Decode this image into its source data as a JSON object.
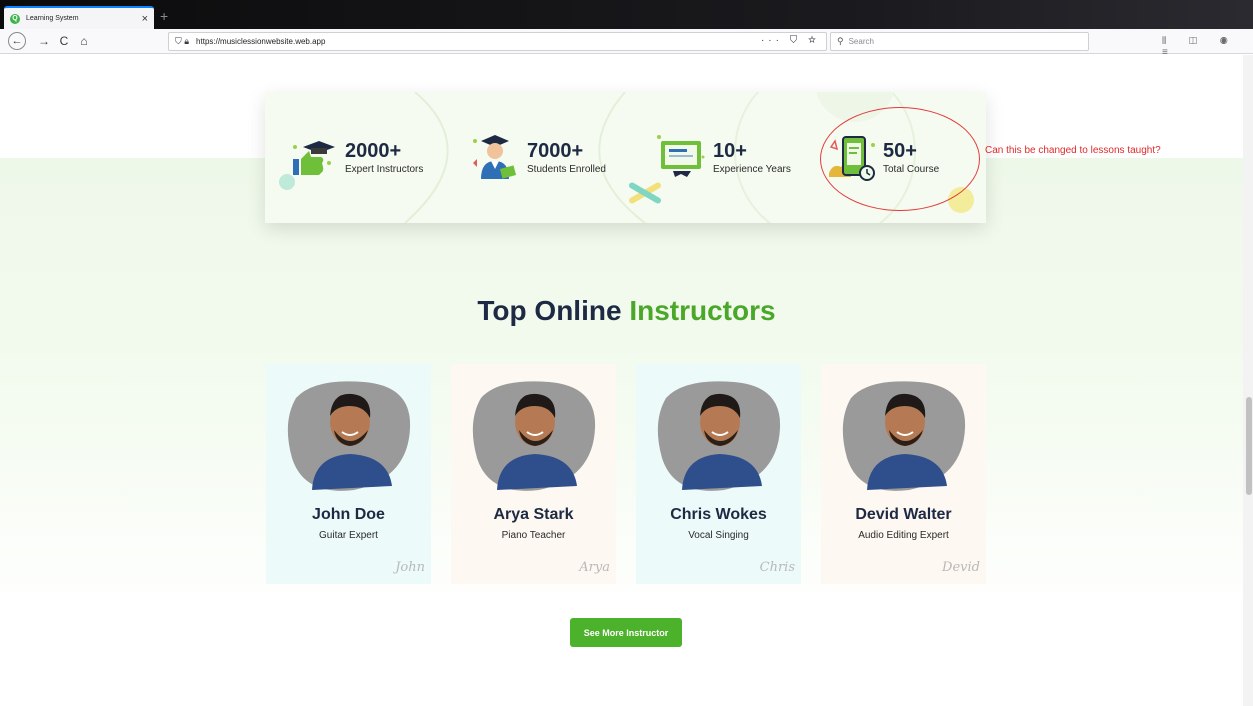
{
  "browser": {
    "tab_title": "Learning System",
    "tab_close": "×",
    "new_tab": "+",
    "url": "https://musiclessionwebsite.web.app",
    "url_actions": "··· ⛉ ☆",
    "search_placeholder": "Search",
    "nav": {
      "back": "←",
      "forward": "→",
      "reload": "C",
      "home": "⌂"
    },
    "right_icons": "⫴ ◫ ◉ ≡"
  },
  "colors": {
    "navy": "#1e2a44",
    "green": "#4aa72a",
    "annotation": "#e23b3b"
  },
  "stats": [
    {
      "value": "2000+",
      "label": "Expert Instructors",
      "icon": "graduation-thumbs-up-icon"
    },
    {
      "value": "7000+",
      "label": "Students Enrolled",
      "icon": "graduate-student-icon"
    },
    {
      "value": "10+",
      "label": "Experience Years",
      "icon": "certificate-icon"
    },
    {
      "value": "50+",
      "label": "Total Course",
      "icon": "tablet-clock-icon"
    }
  ],
  "annotation": {
    "note": "Can this be changed to lessons taught?"
  },
  "section": {
    "title_part1": "Top Online ",
    "title_part2": "Instructors"
  },
  "instructors": [
    {
      "name": "John Doe",
      "role": "Guitar Expert",
      "signature": "John",
      "bg": "#ecfbf9"
    },
    {
      "name": "Arya Stark",
      "role": "Piano Teacher",
      "signature": "Arya",
      "bg": "#fdf8f1"
    },
    {
      "name": "Chris Wokes",
      "role": "Vocal Singing",
      "signature": "Chris",
      "bg": "#ecfbf9"
    },
    {
      "name": "Devid Walter",
      "role": "Audio Editing Expert",
      "signature": "Devid",
      "bg": "#fdf8f1"
    }
  ],
  "cta": {
    "label": "See More Instructor"
  }
}
